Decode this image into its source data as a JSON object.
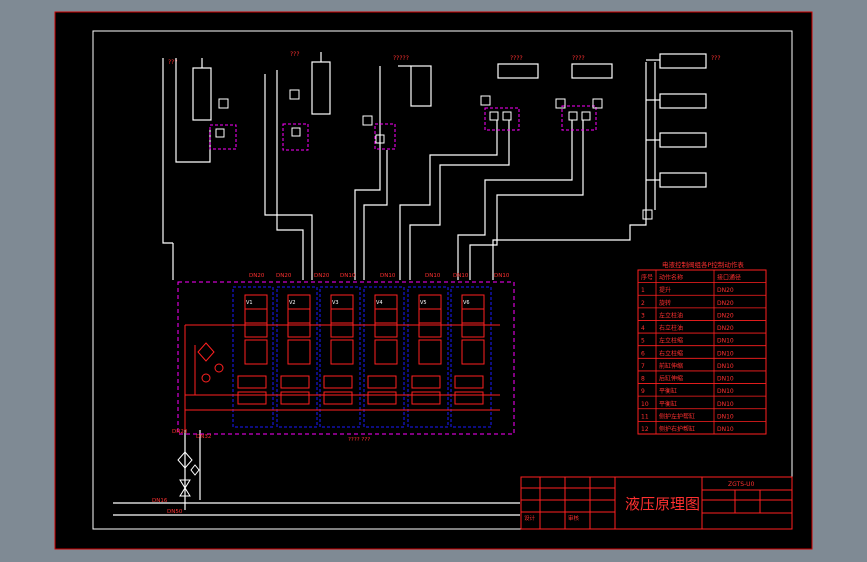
{
  "drawing": {
    "title_block": {
      "title": "液压原理图",
      "drawing_no": "ZGTS-U0",
      "designer_row": "设计",
      "check_row": "审核"
    },
    "cylinder_labels": [
      "???",
      "???",
      "?????",
      "????",
      "????",
      "???"
    ],
    "port_labels": [
      "DN20",
      "DN20",
      "DN20",
      "DN10",
      "DN10",
      "DN10",
      "DN10",
      "DN10"
    ],
    "pipe_labels": {
      "main": "DN16",
      "return": "DN50",
      "pump": "DN20",
      "relief": "DN32",
      "valve_block": "???? ???"
    },
    "valve_labels": [
      "V1",
      "V2",
      "V3",
      "V4",
      "V5",
      "V6"
    ],
    "table": {
      "title": "电液控制阀组各P控制动作表",
      "headers": [
        "序号",
        "动作名称",
        "接口通径"
      ],
      "rows": [
        [
          "1",
          "提升",
          "DN20"
        ],
        [
          "2",
          "旋转",
          "DN20"
        ],
        [
          "3",
          "左立柱油",
          "DN20"
        ],
        [
          "4",
          "右立柱油",
          "DN20"
        ],
        [
          "5",
          "左立柱缩",
          "DN10"
        ],
        [
          "6",
          "右立柱缩",
          "DN10"
        ],
        [
          "7",
          "前缸伸缩",
          "DN10"
        ],
        [
          "8",
          "后缸伸缩",
          "DN10"
        ],
        [
          "9",
          "平衡缸",
          "DN10"
        ],
        [
          "10",
          "平衡缸",
          "DN10"
        ],
        [
          "11",
          "侧护左护帮缸",
          "DN10"
        ],
        [
          "12",
          "侧护右护帮缸",
          "DN10"
        ]
      ]
    },
    "colors": {
      "background": "#000000",
      "outer_bg": "#7f8a94",
      "pipe": "#ffffff",
      "valve": "#ff0000",
      "block": "#ff00ff",
      "frame": "#ff0000",
      "dashed_blue": "#1a1aff"
    }
  }
}
